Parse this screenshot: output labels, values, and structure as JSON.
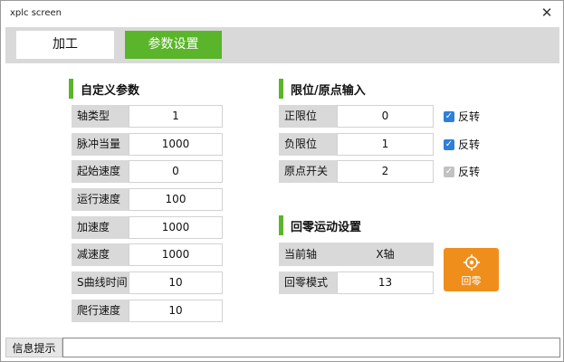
{
  "window": {
    "title": "xplc screen",
    "close_glyph": "✕"
  },
  "tabs": [
    {
      "label": "加工",
      "active": false
    },
    {
      "label": "参数设置",
      "active": true
    }
  ],
  "accent_color": "#5ab52a",
  "home_button_color": "#f08e1c",
  "custom_params": {
    "title": "自定义参数",
    "rows": [
      {
        "label": "轴类型",
        "value": "1"
      },
      {
        "label": "脉冲当量",
        "value": "1000"
      },
      {
        "label": "起始速度",
        "value": "0"
      },
      {
        "label": "运行速度",
        "value": "100"
      },
      {
        "label": "加速度",
        "value": "1000"
      },
      {
        "label": "减速度",
        "value": "1000"
      },
      {
        "label": "S曲线时间",
        "value": "10"
      },
      {
        "label": "爬行速度",
        "value": "10"
      }
    ]
  },
  "limit_inputs": {
    "title": "限位/原点输入",
    "rows": [
      {
        "label": "正限位",
        "value": "0",
        "invert_label": "反转",
        "invert_checked": true,
        "enabled": true
      },
      {
        "label": "负限位",
        "value": "1",
        "invert_label": "反转",
        "invert_checked": true,
        "enabled": true
      },
      {
        "label": "原点开关",
        "value": "2",
        "invert_label": "反转",
        "invert_checked": true,
        "enabled": false
      }
    ]
  },
  "homing": {
    "title": "回零运动设置",
    "current_axis_label": "当前轴",
    "current_axis_value": "X轴",
    "mode_label": "回零模式",
    "mode_value": "13",
    "button_label": "回零",
    "button_icon": "crosshair-icon"
  },
  "status": {
    "label": "信息提示",
    "message": ""
  }
}
